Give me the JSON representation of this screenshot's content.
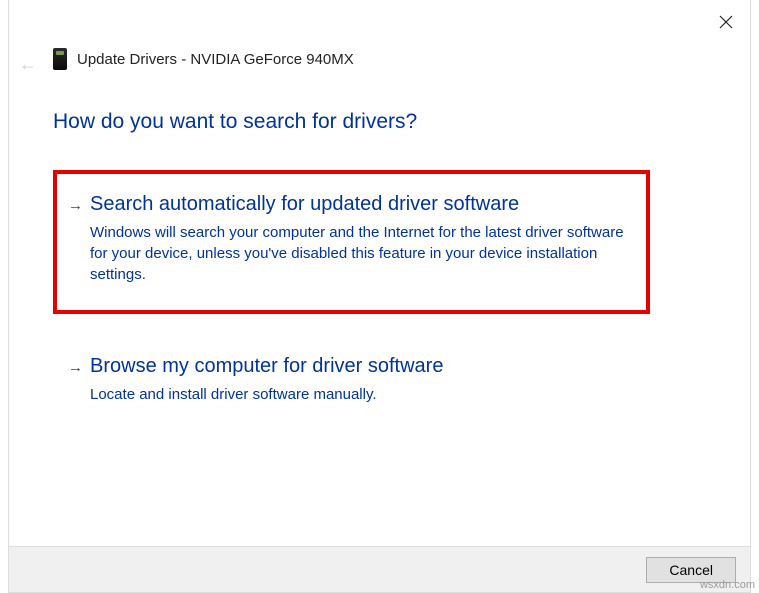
{
  "header": {
    "title": "Update Drivers - NVIDIA GeForce 940MX"
  },
  "heading": "How do you want to search for drivers?",
  "options": [
    {
      "title": "Search automatically for updated driver software",
      "desc": "Windows will search your computer and the Internet for the latest driver software for your device, unless you've disabled this feature in your device installation settings.",
      "highlighted": true
    },
    {
      "title": "Browse my computer for driver software",
      "desc": "Locate and install driver software manually.",
      "highlighted": false
    }
  ],
  "footer": {
    "cancel": "Cancel"
  },
  "watermark": "wsxdn.com"
}
